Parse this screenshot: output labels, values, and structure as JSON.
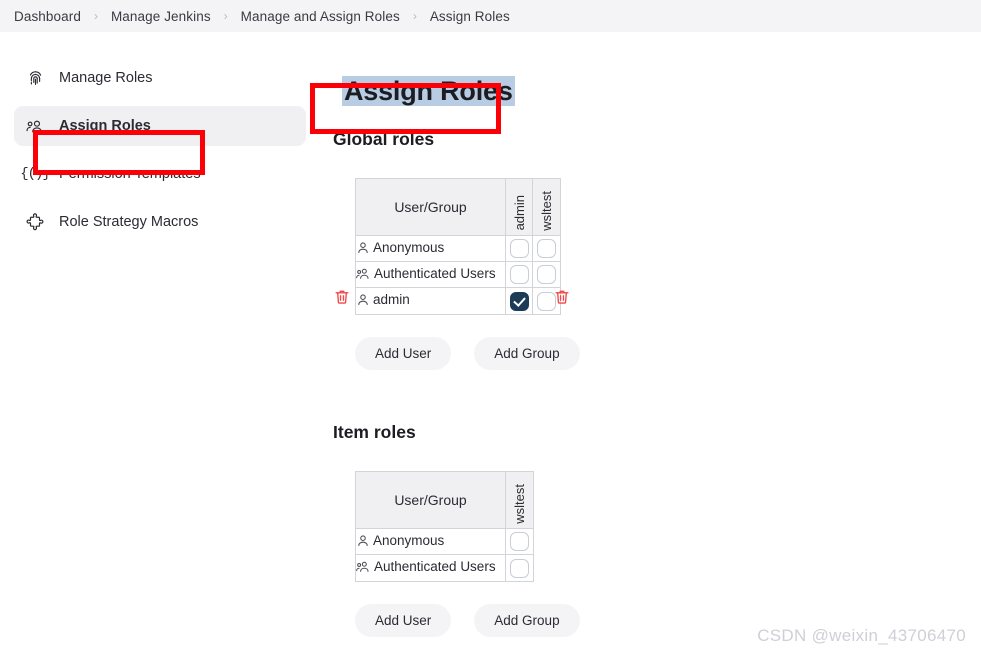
{
  "breadcrumb": {
    "separator": "›",
    "items": [
      {
        "label": "Dashboard"
      },
      {
        "label": "Manage Jenkins"
      },
      {
        "label": "Manage and Assign Roles"
      },
      {
        "label": "Assign Roles"
      }
    ]
  },
  "sidebar": {
    "items": [
      {
        "label": "Manage Roles",
        "icon": "fingerprint-icon",
        "selected": false
      },
      {
        "label": "Assign Roles",
        "icon": "people-icon",
        "selected": true
      },
      {
        "label": "Permission Templates",
        "icon": "braces-icon",
        "selected": false
      },
      {
        "label": "Role Strategy Macros",
        "icon": "puzzle-icon",
        "selected": false
      }
    ]
  },
  "main": {
    "title": "Assign Roles",
    "global_roles": {
      "heading": "Global roles",
      "usergroup_header": "User/Group",
      "role_columns": [
        "admin",
        "wsltest"
      ],
      "rows": [
        {
          "name": "Anonymous",
          "icon": "user-icon",
          "checks": [
            false,
            false
          ],
          "deletable": false
        },
        {
          "name": "Authenticated Users",
          "icon": "users-icon",
          "checks": [
            false,
            false
          ],
          "deletable": false
        },
        {
          "name": "admin",
          "icon": "user-icon",
          "checks": [
            true,
            false
          ],
          "deletable": true
        }
      ],
      "add_user_label": "Add User",
      "add_group_label": "Add Group"
    },
    "item_roles": {
      "heading": "Item roles",
      "usergroup_header": "User/Group",
      "role_columns": [
        "wsltest"
      ],
      "rows": [
        {
          "name": "Anonymous",
          "icon": "user-icon",
          "checks": [
            false
          ],
          "deletable": false
        },
        {
          "name": "Authenticated Users",
          "icon": "users-icon",
          "checks": [
            false
          ],
          "deletable": false
        }
      ],
      "add_user_label": "Add User",
      "add_group_label": "Add Group"
    }
  },
  "annotations": {
    "highlight_color": "#fb0007",
    "selection_color": "#b8cce4",
    "checked_color": "#1b3b56",
    "trash_color": "#f0484a"
  },
  "watermark": {
    "text": "CSDN @weixin_43706470"
  }
}
